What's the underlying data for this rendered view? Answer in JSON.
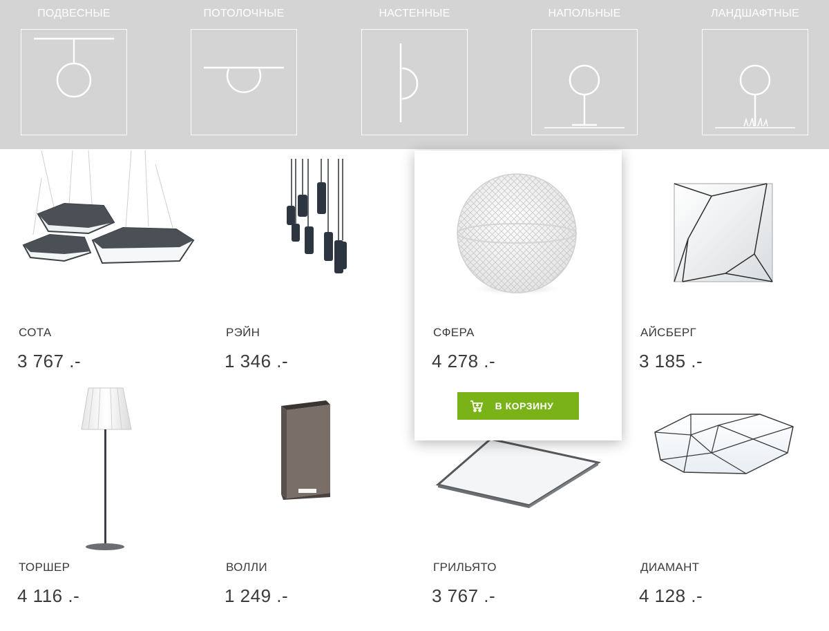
{
  "categories": [
    {
      "label": "ПОДВЕСНЫЕ",
      "icon": "pendant-lamp-icon"
    },
    {
      "label": "ПОТОЛОЧНЫЕ",
      "icon": "ceiling-lamp-icon"
    },
    {
      "label": "НАСТЕННЫЕ",
      "icon": "wall-lamp-icon"
    },
    {
      "label": "НАПОЛЬНЫЕ",
      "icon": "floor-lamp-icon"
    },
    {
      "label": "ЛАНДШАФТНЫЕ",
      "icon": "landscape-lamp-icon"
    }
  ],
  "products": [
    {
      "name": "СОТА",
      "price": "3 767 .-",
      "image": "hexagon-pendant-image"
    },
    {
      "name": "РЭЙН",
      "price": "1 346 .-",
      "image": "cylinder-pendant-image"
    },
    {
      "name": "СФЕРА",
      "price": "4 278 .-",
      "image": "sphere-lamp-image"
    },
    {
      "name": "АЙСБЕРГ",
      "price": "3 185 .-",
      "image": "iceberg-ceiling-image"
    },
    {
      "name": "ТОРШЕР",
      "price": "4 116 .-",
      "image": "floor-lamp-image"
    },
    {
      "name": "ВОЛЛИ",
      "price": "1 249 .-",
      "image": "wall-box-lamp-image"
    },
    {
      "name": "ГРИЛЬЯТО",
      "price": "3 767 .-",
      "image": "square-panel-image"
    },
    {
      "name": "ДИАМАНТ",
      "price": "4 128 .-",
      "image": "diamond-ceiling-image"
    }
  ],
  "cart_button": {
    "label": "В КОРЗИНУ",
    "icon": "cart-icon"
  },
  "colors": {
    "category_bar": "#d4d4d4",
    "accent_green": "#7ab317"
  }
}
